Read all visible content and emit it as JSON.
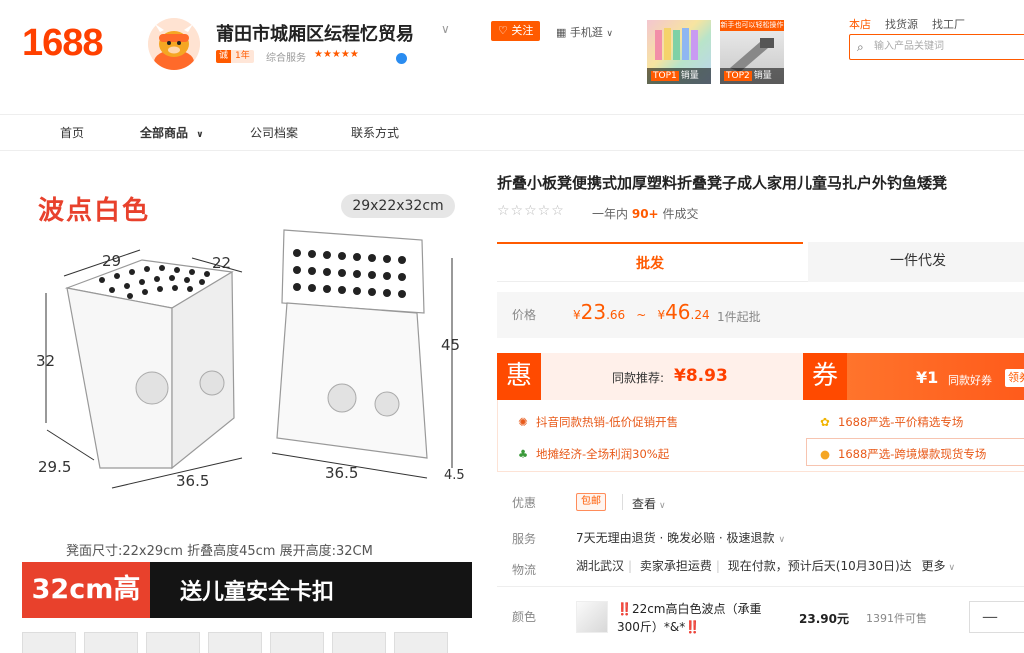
{
  "header": {
    "logo": "1688",
    "shop_name": "莆田市城厢区纭程忆贸易",
    "badge_left": "诚",
    "badge_years": "1年",
    "service_label": "综合服务",
    "service_stars": "★★★★★",
    "follow_label": "关注",
    "mobile_label": "手机逛",
    "top_products": [
      {
        "rank": "TOP1",
        "label": "销量"
      },
      {
        "rank": "TOP2",
        "label": "销量",
        "caption": "新手也可以轻松操作"
      }
    ],
    "scope_tabs": [
      "本店",
      "找货源",
      "找工厂"
    ],
    "search_placeholder": "输入产品关键词"
  },
  "nav": {
    "items": [
      "首页",
      "全部商品",
      "公司档案",
      "联系方式"
    ]
  },
  "gallery": {
    "color_title": "波点白色",
    "dim_pill": "29x22x32cm",
    "dims_left": [
      "29",
      "22",
      "32",
      "29.5",
      "36.5"
    ],
    "dims_right": [
      "45",
      "36.5",
      "4.5"
    ],
    "caption": "凳面尺寸:22x29cm    折叠高度45cm    展开高度:32CM",
    "banner_red": "32cm高",
    "banner_text": "送儿童安全卡扣"
  },
  "product": {
    "title": "折叠小板凳便携式加厚塑料折叠凳子成人家用儿童马扎户外钓鱼矮凳",
    "rating_stars": "☆☆☆☆☆",
    "sold_prefix": "一年内",
    "sold_count": "90+",
    "sold_suffix": "件成交",
    "tab_wholesale": "批发",
    "tab_dropship": "一件代发",
    "price_label": "价格",
    "price_low_int": "23",
    "price_low_dec": ".66",
    "price_tilde": "~",
    "price_high_int": "46",
    "price_high_dec": ".24",
    "currency": "¥",
    "moq": "1件起批",
    "deal_badge": "惠",
    "deal_text": "同款推荐:",
    "deal_price": "¥8.93",
    "coupon_badge": "券",
    "coupon_amount": "¥1",
    "coupon_text": "同款好券",
    "coupon_button": "领券",
    "promos": [
      "抖音同款热销-低价促销开售",
      "1688严选-平价精选专场",
      "地摊经济-全场利润30%起",
      "1688严选-跨境爆款现货专场"
    ],
    "discount_label": "优惠",
    "discount_tag": "包邮",
    "view_label": "查看",
    "service_label": "服务",
    "service_text": "7天无理由退货 · 晚发必赔 · 极速退款",
    "logistics_label": "物流",
    "logistics_from": "湖北武汉",
    "logistics_fee": "卖家承担运费",
    "logistics_eta": "现在付款，预计后天(10月30日)达",
    "logistics_more": "更多",
    "color_label": "颜色",
    "sku_name": "‼️22cm高白色波点（承重300斤）*&*‼️",
    "sku_price": "23.90元",
    "sku_stock": "1391件可售",
    "qty_minus": "—"
  },
  "colors": {
    "accent": "#ff5a00",
    "brand": "#ff4000",
    "title_red": "#e8412c"
  }
}
